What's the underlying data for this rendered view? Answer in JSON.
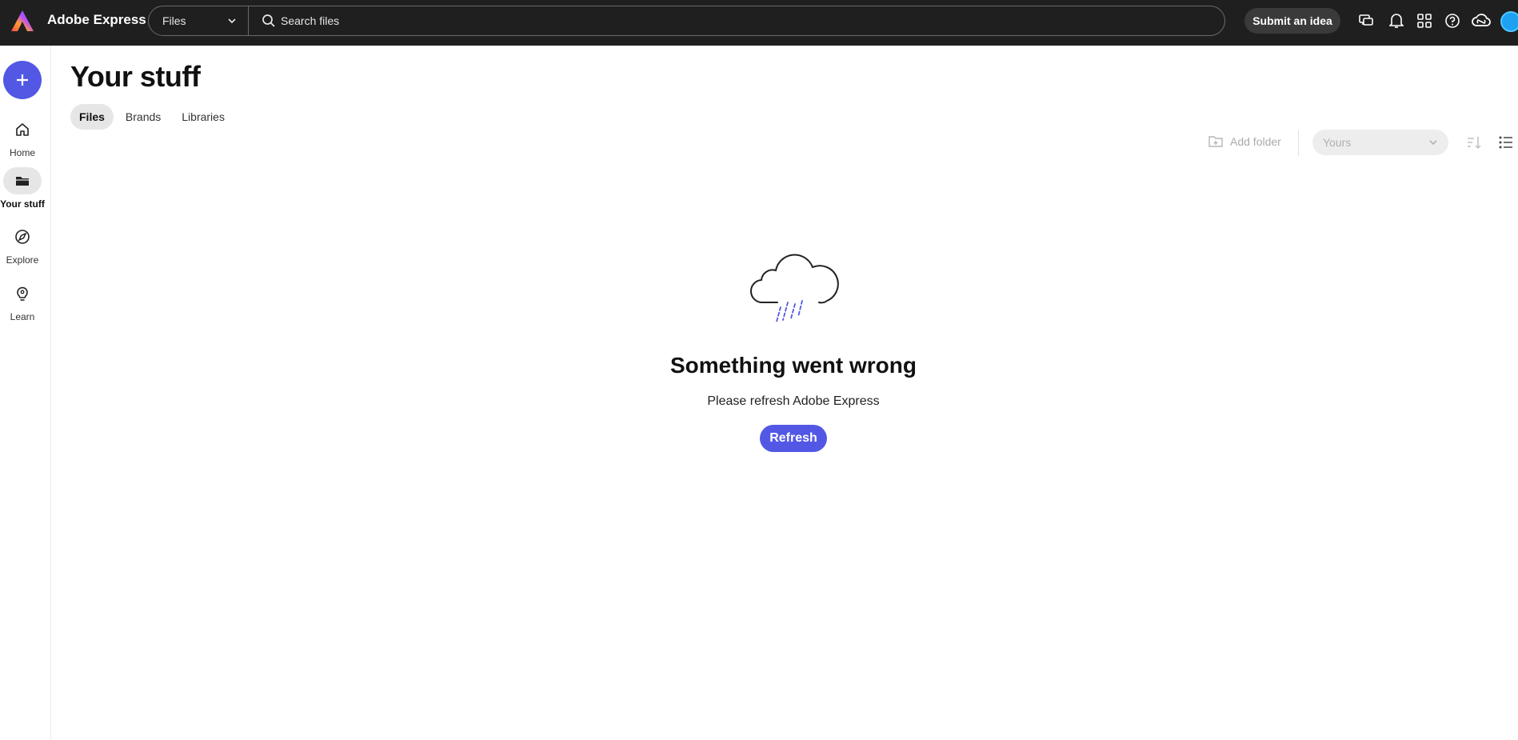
{
  "app": {
    "title": "Adobe Express"
  },
  "search": {
    "scope": "Files",
    "placeholder": "Search files"
  },
  "header": {
    "submit_label": "Submit an idea"
  },
  "rail": {
    "items": [
      {
        "label": "Home"
      },
      {
        "label": "Your stuff"
      },
      {
        "label": "Explore"
      },
      {
        "label": "Learn"
      }
    ]
  },
  "main": {
    "title": "Your stuff",
    "tabs": [
      {
        "label": "Files"
      },
      {
        "label": "Brands"
      },
      {
        "label": "Libraries"
      }
    ],
    "toolbar": {
      "add_folder_label": "Add folder",
      "owner_value": "Yours"
    }
  },
  "error": {
    "title": "Something went wrong",
    "message": "Please refresh Adobe Express",
    "button_label": "Refresh"
  },
  "colors": {
    "accent": "#5258e4",
    "topbar": "#1f1f1f"
  }
}
